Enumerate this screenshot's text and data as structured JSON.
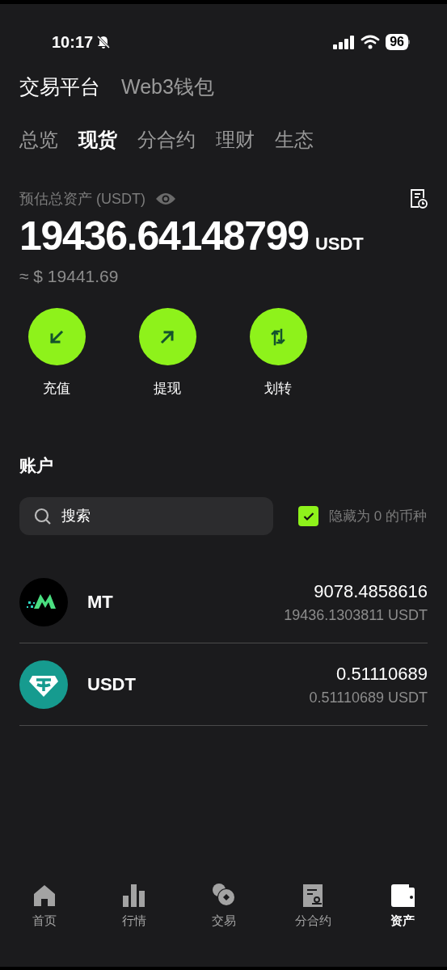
{
  "status_bar": {
    "time": "10:17",
    "battery": "96"
  },
  "top_tabs": [
    {
      "label": "交易平台",
      "selected": true
    },
    {
      "label": "Web3钱包",
      "selected": false
    }
  ],
  "sub_tabs": [
    {
      "label": "总览",
      "selected": false
    },
    {
      "label": "现货",
      "selected": true
    },
    {
      "label": "分合约",
      "selected": false
    },
    {
      "label": "理财",
      "selected": false
    },
    {
      "label": "生态",
      "selected": false
    }
  ],
  "balance": {
    "label": "预估总资产 (USDT)",
    "amount": "19436.64148799",
    "unit": "USDT",
    "approx": "≈ $ 19441.69"
  },
  "actions": [
    {
      "kind": "deposit",
      "label": "充值"
    },
    {
      "kind": "withdraw",
      "label": "提现"
    },
    {
      "kind": "transfer",
      "label": "划转"
    }
  ],
  "accounts": {
    "title": "账户",
    "search": {
      "placeholder": "搜索"
    },
    "hide_zero": {
      "label": "隐藏为 0 的币种",
      "checked": true
    },
    "rows": [
      {
        "kind": "mt",
        "symbol": "MT",
        "amount": "9078.4858616",
        "value": "19436.1303811 USDT"
      },
      {
        "kind": "usdt",
        "symbol": "USDT",
        "amount": "0.51110689",
        "value": "0.51110689 USDT"
      }
    ]
  },
  "bottom_nav": [
    {
      "kind": "home",
      "label": "首页",
      "selected": false
    },
    {
      "kind": "market",
      "label": "行情",
      "selected": false
    },
    {
      "kind": "trade",
      "label": "交易",
      "selected": false
    },
    {
      "kind": "contract",
      "label": "分合约",
      "selected": false
    },
    {
      "kind": "assets",
      "label": "资产",
      "selected": true
    }
  ]
}
